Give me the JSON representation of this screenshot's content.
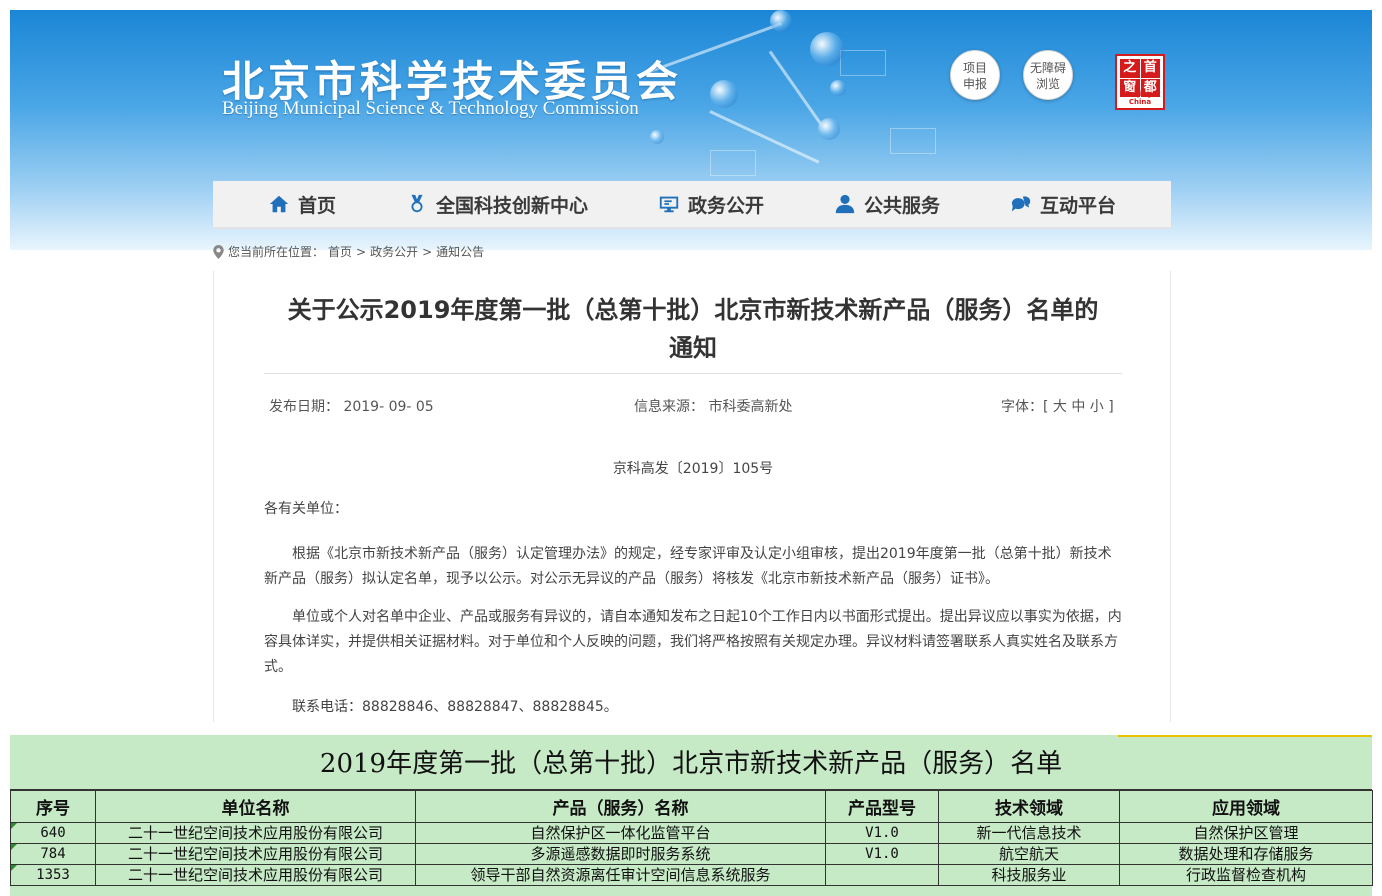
{
  "header": {
    "title_zh": "北京市科学技术委员会",
    "title_en": "Beijing Municipal Science & Technology Commission",
    "btn_project": [
      "项目",
      "申报"
    ],
    "btn_accessible": [
      "无障碍",
      "浏览"
    ],
    "seal_chars": [
      "首",
      "都",
      "之",
      "窗"
    ],
    "seal_sub": "Beijing-China"
  },
  "nav": [
    {
      "label": "首页",
      "icon": "home-icon"
    },
    {
      "label": "全国科技创新中心",
      "icon": "medal-icon"
    },
    {
      "label": "政务公开",
      "icon": "monitor-icon"
    },
    {
      "label": "公共服务",
      "icon": "person-icon"
    },
    {
      "label": "互动平台",
      "icon": "chat-icon"
    }
  ],
  "breadcrumb": {
    "prefix": "您当前所在位置：",
    "items": [
      "首页",
      "政务公开",
      "通知公告"
    ],
    "sep": ">"
  },
  "article": {
    "title_line1": "关于公示2019年度第一批（总第十批）北京市新技术新产品（服务）名单的",
    "title_line2": "通知",
    "date": "发布日期： 2019- 09- 05",
    "source": "信息来源： 市科委高新处",
    "font_size_label": "字体：[ 大 中 小 ]",
    "doc_no": "京科高发〔2019〕105号",
    "salutation": "各有关单位：",
    "para1": "根据《北京市新技术新产品（服务）认定管理办法》的规定，经专家评审及认定小组审核，提出2019年度第一批（总第十批）新技术新产品（服务）拟认定名单，现予以公示。对公示无异议的产品（服务）将核发《北京市新技术新产品（服务）证书》。",
    "para2": "单位或个人对名单中企业、产品或服务有异议的，请自本通知发布之日起10个工作日内以书面形式提出。提出异议应以事实为依据，内容具体详实，并提供相关证据材料。对于单位和个人反映的问题，我们将严格按照有关规定办理。异议材料请签署联系人真实姓名及联系方式。",
    "para3": "联系电话：88828846、88828847、88828845。"
  },
  "sheet": {
    "title": "2019年度第一批（总第十批）北京市新技术新产品（服务）名单",
    "headers": [
      "序号",
      "单位名称",
      "产品（服务）名称",
      "产品型号",
      "技术领域",
      "应用领域"
    ],
    "rows": [
      [
        "640",
        "二十一世纪空间技术应用股份有限公司",
        "自然保护区一体化监管平台",
        "V1.0",
        "新一代信息技术",
        "自然保护区管理"
      ],
      [
        "784",
        "二十一世纪空间技术应用股份有限公司",
        "多源遥感数据即时服务系统",
        "V1.0",
        "航空航天",
        "数据处理和存储服务"
      ],
      [
        "1353",
        "二十一世纪空间技术应用股份有限公司",
        "领导干部自然资源离任审计空间信息系统服务",
        "",
        "科技服务业",
        "行政监督检查机构"
      ]
    ]
  }
}
